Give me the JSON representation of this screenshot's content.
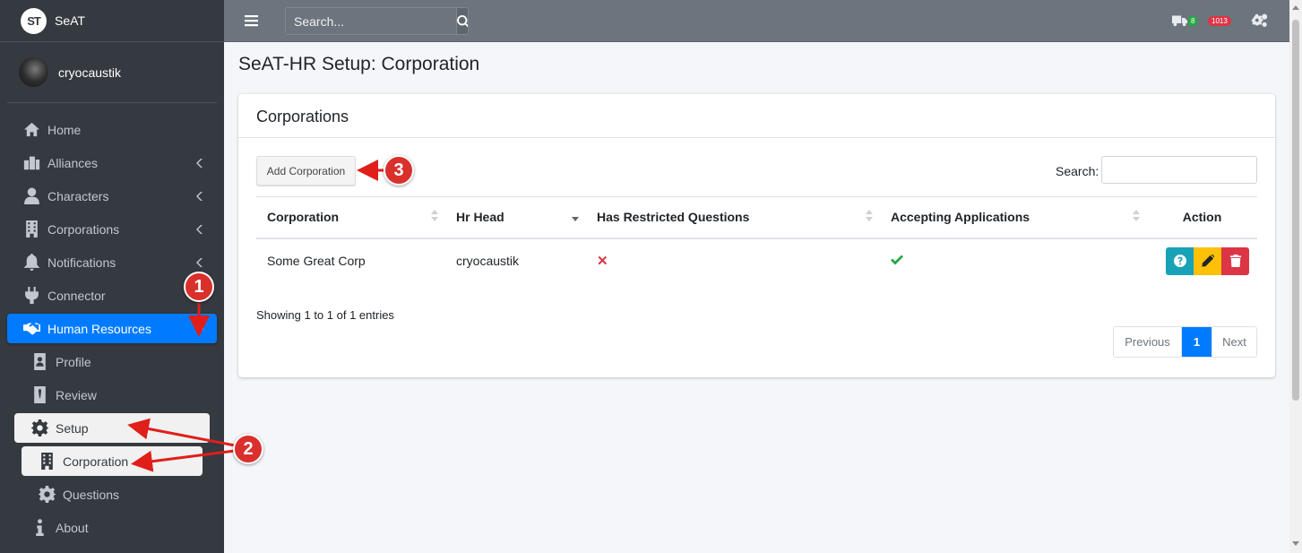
{
  "brand": {
    "logo": "ST",
    "name": "SeAT"
  },
  "user": {
    "name": "cryocaustik"
  },
  "nav": {
    "home": "Home",
    "alliances": "Alliances",
    "characters": "Characters",
    "corporations": "Corporations",
    "notifications": "Notifications",
    "connector": "Connector",
    "human_resources": "Human Resources",
    "profile": "Profile",
    "review": "Review",
    "setup": "Setup",
    "corporation": "Corporation",
    "questions": "Questions",
    "about": "About"
  },
  "header": {
    "search_placeholder": "Search...",
    "queue_badge": "8",
    "error_badge": "1013"
  },
  "page": {
    "title": "SeAT-HR Setup: Corporation"
  },
  "card": {
    "title": "Corporations",
    "add_button": "Add Corporation",
    "search_label": "Search:",
    "columns": [
      "Corporation",
      "Hr Head",
      "Has Restricted Questions",
      "Accepting Applications",
      "Action"
    ],
    "rows": [
      {
        "corporation": "Some Great Corp",
        "hr_head": "cryocaustik",
        "restricted": "✕",
        "accepting": "check"
      }
    ],
    "info": "Showing 1 to 1 of 1 entries",
    "pagination": {
      "previous": "Previous",
      "page": "1",
      "next": "Next"
    }
  },
  "annotations": {
    "step1": "1",
    "step2": "2",
    "step3": "3"
  },
  "colors": {
    "accent": "#007bff",
    "sidebar": "#343a40",
    "header": "#6c757d",
    "annotation": "#d9302c"
  }
}
